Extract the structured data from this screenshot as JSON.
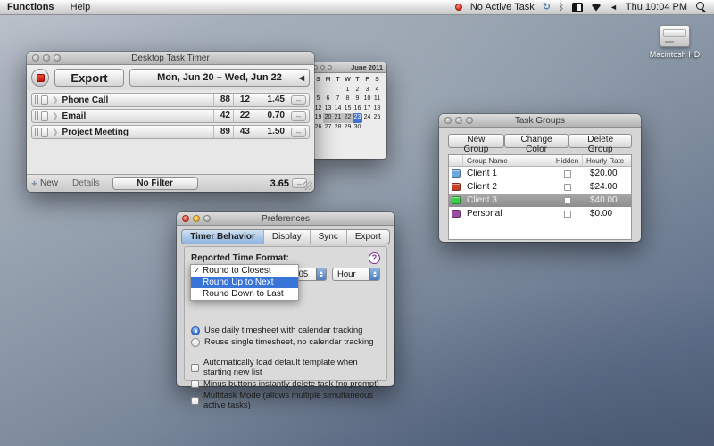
{
  "menubar": {
    "menus": [
      "Functions",
      "Help"
    ],
    "status": {
      "active_task": "No Active Task",
      "clock": "Thu 10:04 PM",
      "icons": {
        "sync": "↻",
        "bluetooth": "ᛒ",
        "volume": "◄"
      }
    }
  },
  "desktop": {
    "volume_label": "Macintosh HD"
  },
  "timer_window": {
    "title": "Desktop Task Timer",
    "export_label": "Export",
    "date_range": "Mon, Jun 20 – Wed, Jun 22",
    "date_nav_glyph": "◀",
    "expand_glyph": "❯",
    "minus_label": "–",
    "rows": [
      {
        "name": "Phone Call",
        "v1": "88",
        "v2": "12",
        "total": "1.45"
      },
      {
        "name": "Email",
        "v1": "42",
        "v2": "22",
        "total": "0.70"
      },
      {
        "name": "Project Meeting",
        "v1": "89",
        "v2": "43",
        "total": "1.50"
      }
    ],
    "footer": {
      "plus_glyph": "+",
      "new_label": "New",
      "details_label": "Details",
      "filter_label": "No Filter",
      "total": "3.65"
    }
  },
  "calendar_window": {
    "title": "June 2011",
    "day_headers": [
      "S",
      "M",
      "T",
      "W",
      "T",
      "F",
      "S"
    ],
    "weeks": [
      [
        "",
        "",
        "",
        "1",
        "2",
        "3",
        "4"
      ],
      [
        "5",
        "6",
        "7",
        "8",
        "9",
        "10",
        "11"
      ],
      [
        "12",
        "13",
        "14",
        "15",
        "16",
        "17",
        "18"
      ],
      [
        "19",
        "20",
        "21",
        "22",
        "23",
        "24",
        "25"
      ],
      [
        "26",
        "27",
        "28",
        "29",
        "30",
        "",
        ""
      ]
    ],
    "highlight_range": [
      "20",
      "21",
      "22"
    ],
    "selected_day": "23"
  },
  "task_groups_window": {
    "title": "Task Groups",
    "buttons": {
      "new": "New Group",
      "change_color": "Change Color",
      "delete": "Delete Group"
    },
    "columns": {
      "name": "Group Name",
      "hidden": "Hidden",
      "rate": "Hourly Rate"
    },
    "rows": [
      {
        "name": "Client 1",
        "color": "#6fa8dc",
        "rate": "$20.00",
        "hidden": false,
        "selected": false
      },
      {
        "name": "Client 2",
        "color": "#c7402d",
        "rate": "$24.00",
        "hidden": false,
        "selected": false
      },
      {
        "name": "Client 3",
        "color": "#3ecf4a",
        "rate": "$40.00",
        "hidden": false,
        "selected": true
      },
      {
        "name": "Personal",
        "color": "#9a4fa0",
        "rate": "$0.00",
        "hidden": false,
        "selected": false
      }
    ]
  },
  "preferences_window": {
    "title": "Preferences",
    "tabs": [
      "Timer Behavior",
      "Display",
      "Sync",
      "Export"
    ],
    "selected_tab": "Timer Behavior",
    "section_label": "Reported Time Format:",
    "help_glyph": "?",
    "dropdown": {
      "checkmark": "✓",
      "items": [
        "Round to Closest",
        "Round Up to Next",
        "Round Down to Last"
      ],
      "checked": "Round to Closest",
      "highlighted": "Round Up to Next"
    },
    "increment_value": ".05",
    "unit_value": "Hour",
    "radios": [
      {
        "label": "Use daily timesheet with calendar tracking",
        "selected": true
      },
      {
        "label": "Reuse single timesheet, no calendar tracking",
        "selected": false
      }
    ],
    "checkboxes": [
      {
        "label": "Automatically load default template when starting new list",
        "checked": false
      },
      {
        "label": "Minus buttons instantly delete task (no prompt)",
        "checked": false
      },
      {
        "label": "Multitask Mode (allows multiple simultaneous active tasks)",
        "checked": false
      }
    ]
  }
}
